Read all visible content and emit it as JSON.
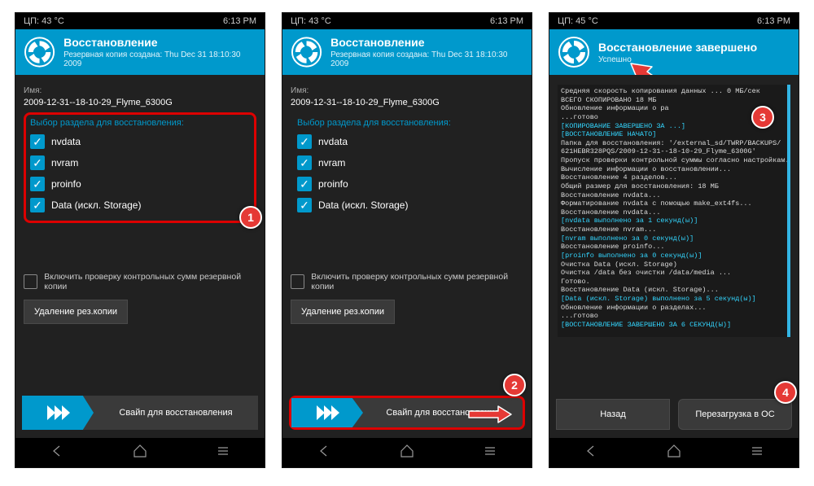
{
  "screens": [
    {
      "status": {
        "cpu": "ЦП: 43 °C",
        "time": "6:13 PM"
      },
      "header": {
        "title": "Восстановление",
        "subtitle": "Резервная копия создана: Thu Dec 31 18:10:30 2009"
      },
      "name_label": "Имя:",
      "name_value": "2009-12-31--18-10-29_Flyme_6300G",
      "selector_title": "Выбор раздела для восстановления:",
      "partitions": [
        "nvdata",
        "nvram",
        "proinfo",
        "Data (искл. Storage)"
      ],
      "md5_label": "Включить проверку контрольных сумм резервной копии",
      "delete_label": "Удаление рез.копии",
      "swipe_label": "Свайп для восстановления",
      "badge": "1"
    },
    {
      "status": {
        "cpu": "ЦП: 43 °C",
        "time": "6:13 PM"
      },
      "header": {
        "title": "Восстановление",
        "subtitle": "Резервная копия создана: Thu Dec 31 18:10:30 2009"
      },
      "name_label": "Имя:",
      "name_value": "2009-12-31--18-10-29_Flyme_6300G",
      "selector_title": "Выбор раздела для восстановления:",
      "partitions": [
        "nvdata",
        "nvram",
        "proinfo",
        "Data (искл. Storage)"
      ],
      "md5_label": "Включить проверку контрольных сумм резервной копии",
      "delete_label": "Удаление рез.копии",
      "swipe_label": "Свайп для восстановления",
      "badge": "2"
    },
    {
      "status": {
        "cpu": "ЦП: 45 °C",
        "time": "6:13 PM"
      },
      "header": {
        "title": "Восстановление завершено",
        "subtitle": "Успешно"
      },
      "log_lines": [
        {
          "t": "Средняя скорость копирования данных ... 0 МБ/сек",
          "c": 0
        },
        {
          "t": "ВСЕГО СКОПИРОВАНО 18 МБ",
          "c": 0
        },
        {
          "t": "Обновление информации о ра",
          "c": 0
        },
        {
          "t": "...готово",
          "c": 0
        },
        {
          "t": "[КОПИРОВАНИЕ ЗАВЕРШЕНО ЗА ...]",
          "c": 1
        },
        {
          "t": "[ВОССТАНОВЛЕНИЕ НАЧАТО]",
          "c": 1
        },
        {
          "t": "Папка для восстановления: '/external_sd/TWRP/BACKUPS/",
          "c": 0
        },
        {
          "t": "621HEBR328PQS/2009-12-31--18-10-29_Flyme_6300G'",
          "c": 0
        },
        {
          "t": "Пропуск проверки контрольной суммы согласно настройкам.",
          "c": 0
        },
        {
          "t": "Вычисление информации о восстановлении...",
          "c": 0
        },
        {
          "t": "Восстановление 4 разделов...",
          "c": 0
        },
        {
          "t": "Общий размер для восстановления: 18 МБ",
          "c": 0
        },
        {
          "t": "Восстановление nvdata...",
          "c": 0
        },
        {
          "t": "Форматирование nvdata с помощью make_ext4fs...",
          "c": 0
        },
        {
          "t": "Восстановление nvdata...",
          "c": 0
        },
        {
          "t": "[nvdata выполнено за 1 секунд(ы)]",
          "c": 1
        },
        {
          "t": "Восстановление nvram...",
          "c": 0
        },
        {
          "t": "[nvram выполнено за 0 секунд(ы)]",
          "c": 1
        },
        {
          "t": "Восстановление proinfo...",
          "c": 0
        },
        {
          "t": "[proinfo выполнено за 0 секунд(ы)]",
          "c": 1
        },
        {
          "t": "Очистка Data (искл. Storage)",
          "c": 0
        },
        {
          "t": "Очистка /data без очистки /data/media ...",
          "c": 0
        },
        {
          "t": "Готово.",
          "c": 0
        },
        {
          "t": "Восстановление Data (искл. Storage)...",
          "c": 0
        },
        {
          "t": "[Data (искл. Storage) выполнено за 5 секунд(ы)]",
          "c": 1
        },
        {
          "t": "Обновление информации о разделах...",
          "c": 0
        },
        {
          "t": "...готово",
          "c": 0
        },
        {
          "t": "[ВОССТАНОВЛЕНИЕ ЗАВЕРШЕНО ЗА 6 СЕКУНД(Ы)]",
          "c": 1
        }
      ],
      "back_label": "Назад",
      "reboot_label": "Перезагрузка в ОС",
      "badge3": "3",
      "badge4": "4"
    }
  ]
}
